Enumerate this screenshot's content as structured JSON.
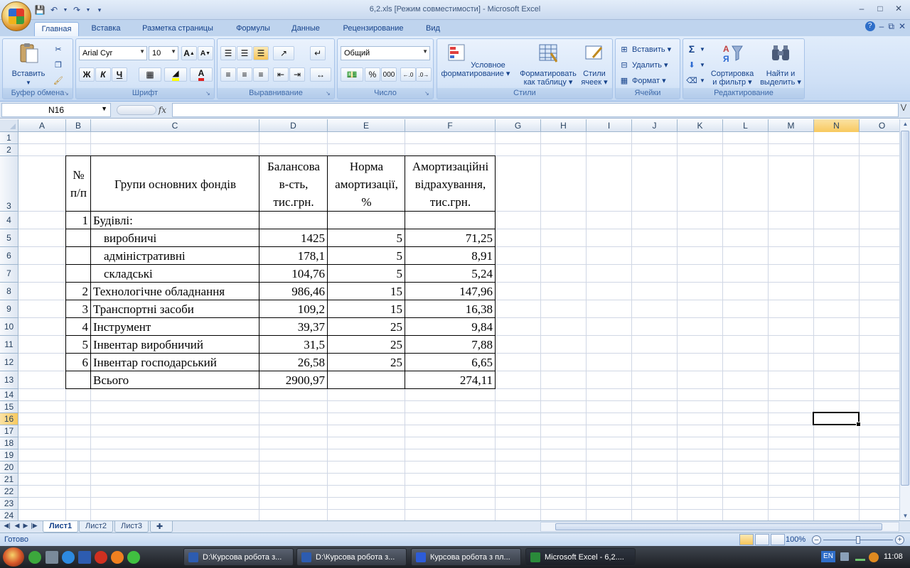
{
  "window": {
    "title": "6,2.xls  [Режим совместимости] - Microsoft Excel"
  },
  "tabs": [
    "Главная",
    "Вставка",
    "Разметка страницы",
    "Формулы",
    "Данные",
    "Рецензирование",
    "Вид"
  ],
  "ribbon": {
    "clipboard": {
      "label": "Буфер обмена",
      "paste": "Вставить"
    },
    "font": {
      "label": "Шрифт",
      "name": "Arial Cyr",
      "size": "10",
      "bold": "Ж",
      "italic": "К",
      "underline": "Ч"
    },
    "alignment": {
      "label": "Выравнивание"
    },
    "number": {
      "label": "Число",
      "format": "Общий",
      "percent": "%",
      "thousands": "000"
    },
    "styles": {
      "label": "Стили",
      "conditional": [
        "Условное",
        "форматирование ▾"
      ],
      "table": [
        "Форматировать",
        "как таблицу ▾"
      ],
      "cell_styles": [
        "Стили",
        "ячеек ▾"
      ]
    },
    "cells": {
      "label": "Ячейки",
      "insert": "Вставить ▾",
      "delete": "Удалить ▾",
      "format": "Формат ▾"
    },
    "editing": {
      "label": "Редактирование",
      "sort": [
        "Сортировка",
        "и фильтр ▾"
      ],
      "find": [
        "Найти и",
        "выделить ▾"
      ]
    }
  },
  "formula_bar": {
    "name_box": "N16",
    "fx": "fx",
    "value": ""
  },
  "columns": [
    "A",
    "B",
    "C",
    "D",
    "E",
    "F",
    "G",
    "H",
    "I",
    "J",
    "K",
    "L",
    "M",
    "N",
    "O"
  ],
  "selected_column": "N",
  "selected_row": 16,
  "rows": [
    "1",
    "2",
    "3",
    "4",
    "5",
    "6",
    "7",
    "8",
    "9",
    "10",
    "11",
    "12",
    "13",
    "14",
    "15",
    "16",
    "17",
    "18",
    "19",
    "20",
    "21",
    "22",
    "23",
    "24"
  ],
  "table": {
    "header": {
      "num": [
        "№",
        "п/п"
      ],
      "group": "Групи основних фондів",
      "balance": [
        "Балансова",
        "в-сть,",
        "тис.грн."
      ],
      "rate": [
        "Норма",
        "амортизації,",
        "%"
      ],
      "deduction": [
        "Амортизаційні",
        "відрахування,",
        "тис.грн."
      ]
    },
    "rows": [
      {
        "num": "1",
        "name": "Будівлі:",
        "balance": "",
        "rate": "",
        "deduction": "",
        "indent": false
      },
      {
        "num": "",
        "name": "виробничі",
        "balance": "1425",
        "rate": "5",
        "deduction": "71,25",
        "indent": true
      },
      {
        "num": "",
        "name": "адміністративні",
        "balance": "178,1",
        "rate": "5",
        "deduction": "8,91",
        "indent": true
      },
      {
        "num": "",
        "name": "складські",
        "balance": "104,76",
        "rate": "5",
        "deduction": "5,24",
        "indent": true
      },
      {
        "num": "2",
        "name": "Технологічне обладнання",
        "balance": "986,46",
        "rate": "15",
        "deduction": "147,96",
        "indent": false
      },
      {
        "num": "3",
        "name": "Транспортні засоби",
        "balance": "109,2",
        "rate": "15",
        "deduction": "16,38",
        "indent": false
      },
      {
        "num": "4",
        "name": "Інструмент",
        "balance": "39,37",
        "rate": "25",
        "deduction": "9,84",
        "indent": false
      },
      {
        "num": "5",
        "name": "Інвентар виробничий",
        "balance": "31,5",
        "rate": "25",
        "deduction": "7,88",
        "indent": false
      },
      {
        "num": "6",
        "name": "Інвентар господарський",
        "balance": "26,58",
        "rate": "25",
        "deduction": "6,65",
        "indent": false
      },
      {
        "num": "",
        "name": "Всього",
        "balance": "2900,97",
        "rate": "",
        "deduction": "274,11",
        "indent": false
      }
    ]
  },
  "sheets": [
    "Лист1",
    "Лист2",
    "Лист3"
  ],
  "active_sheet": "Лист1",
  "status": {
    "text": "Готово",
    "zoom": "100%"
  },
  "taskbar": {
    "tasks": [
      "D:\\Курсова робота з...",
      "D:\\Курсова робота з...",
      "Курсова робота з пл...",
      "Microsoft Excel - 6,2...."
    ],
    "active_task": 3,
    "lang": "EN",
    "clock": "11:08"
  }
}
